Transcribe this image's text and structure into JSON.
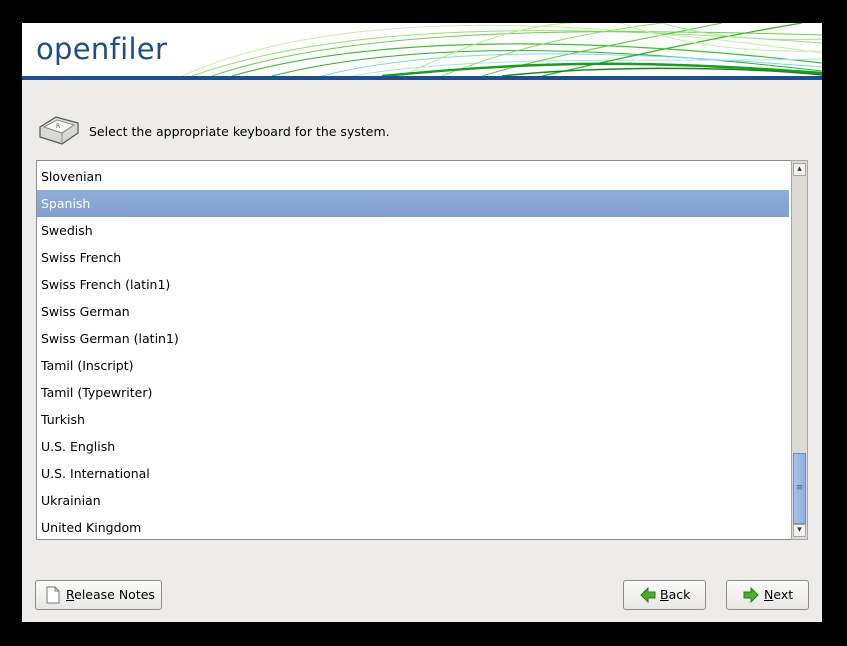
{
  "banner": {
    "logo_text": "openfiler",
    "bar_color": "#1f4f8a",
    "logo_color": "#1d4e88"
  },
  "prompt": {
    "icon": "keyboard-key-icon",
    "text": "Select the appropriate keyboard for the system."
  },
  "keyboard_list": {
    "selected": "Spanish",
    "items": [
      "Slovenian",
      "Spanish",
      "Swedish",
      "Swiss French",
      "Swiss French (latin1)",
      "Swiss German",
      "Swiss German (latin1)",
      "Tamil (Inscript)",
      "Tamil (Typewriter)",
      "Turkish",
      "U.S. English",
      "U.S. International",
      "Ukrainian",
      "United Kingdom"
    ],
    "selection_color": "#86a6d4"
  },
  "buttons": {
    "release_notes": {
      "first": "R",
      "rest": "elease Notes",
      "icon": "document-icon"
    },
    "back": {
      "first": "B",
      "rest": "ack",
      "icon": "arrow-left-icon"
    },
    "next": {
      "first": "N",
      "rest": "ext",
      "icon": "arrow-right-icon"
    }
  }
}
